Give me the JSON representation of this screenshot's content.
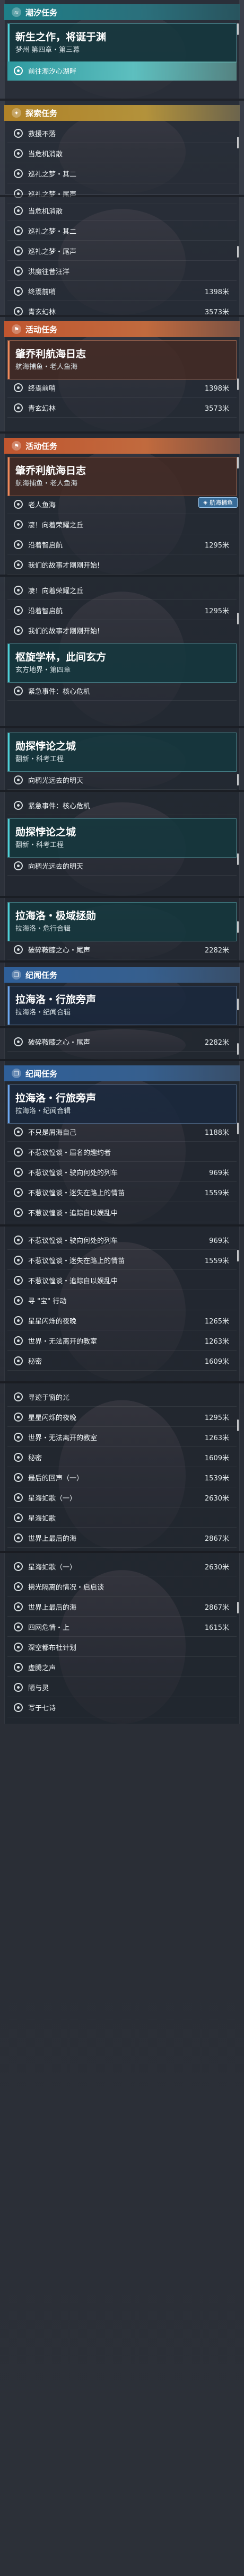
{
  "colors": {
    "teal": "#1e7f88",
    "gold": "#b08228",
    "orange": "#c0562f",
    "blue": "#2f5f98",
    "highlight": "#5dbfbf"
  },
  "screens": [
    {
      "header": {
        "icon": "wave-icon",
        "title": "潮汐任务"
      },
      "card": {
        "title": "新生之作，将诞于渊",
        "subtitle": "梦州 第四章・第三幕"
      },
      "rows": [
        {
          "label": "前往潮汐心湖畔",
          "distance": "",
          "active": true
        }
      ]
    },
    {
      "header": {
        "icon": "compass-icon",
        "title": "探索任务"
      },
      "rows": [
        {
          "label": "救援不落",
          "distance": ""
        },
        {
          "label": "当危机消散",
          "distance": ""
        },
        {
          "label": "巡礼之梦・其二",
          "distance": ""
        },
        {
          "label": "巡礼之梦・尾声",
          "distance": ""
        }
      ]
    },
    {
      "rows": [
        {
          "label": "当危机消散",
          "distance": ""
        },
        {
          "label": "巡礼之梦・其二",
          "distance": ""
        },
        {
          "label": "巡礼之梦・尾声",
          "distance": ""
        },
        {
          "label": "洪魔往昔汪洋",
          "distance": ""
        },
        {
          "label": "终焉前哨",
          "distance": "1398米"
        },
        {
          "label": "青玄幻林",
          "distance": "3573米"
        }
      ]
    },
    {
      "header": {
        "icon": "flag-icon",
        "title": "活动任务"
      },
      "card": {
        "title": "肇乔利航海日志",
        "subtitle": "航海捕鱼・老人鱼海"
      },
      "rows": [
        {
          "label": "终焉前哨",
          "distance": "1398米"
        },
        {
          "label": "青玄幻林",
          "distance": "3573米"
        }
      ]
    },
    {
      "header": {
        "icon": "flag-icon",
        "title": "活动任务"
      },
      "card": {
        "title": "肇乔利航海日志",
        "subtitle": "航海捕鱼・老人鱼海"
      },
      "badge": {
        "icon": "map-icon",
        "label": "航海捕鱼"
      },
      "rows": [
        {
          "label": "老人鱼海",
          "distance": ""
        },
        {
          "label": "凄！向着荣耀之丘",
          "distance": ""
        },
        {
          "label": "沿着智启航",
          "distance": "1295米"
        },
        {
          "label": "我们的故事才刚刚开始!",
          "distance": ""
        }
      ]
    },
    {
      "rows": [
        {
          "label": "凄！向着荣耀之丘",
          "distance": ""
        },
        {
          "label": "沿着智启航",
          "distance": "1295米"
        },
        {
          "label": "我们的故事才刚刚开始!",
          "distance": ""
        }
      ],
      "card": {
        "title": "枢旋学林，此间玄方",
        "subtitle": "玄方地界・第四章"
      },
      "rows2": [
        {
          "label": "紧急事件：核心危机",
          "distance": ""
        }
      ]
    },
    {
      "card": {
        "title": "勋探悖论之城",
        "subtitle": "翻新・科考工程"
      },
      "rows": [
        {
          "label": "向稠光远去的明天",
          "distance": ""
        }
      ]
    },
    {
      "rows": [
        {
          "label": "紧急事件：核心危机",
          "distance": ""
        }
      ],
      "card": {
        "title": "勋探悖论之城",
        "subtitle": "翻新・科考工程"
      },
      "rows2": [
        {
          "label": "向稠光远去的明天",
          "distance": ""
        }
      ]
    },
    {
      "card": {
        "title": "拉海洛・极域拯勋",
        "subtitle": "拉海洛・危行合辑"
      },
      "rows": [
        {
          "label": "破碎鞍膝之心・尾声",
          "distance": "2282米"
        }
      ]
    },
    {
      "header": {
        "icon": "book-icon",
        "title": "纪闻任务"
      },
      "card": {
        "title": "拉海洛・行旅旁声",
        "subtitle": "拉海洛・纪闻合辑"
      }
    },
    {
      "rows": [
        {
          "label": "破碎鞍膝之心・尾声",
          "distance": "2282米"
        }
      ]
    },
    {
      "header": {
        "icon": "book-icon",
        "title": "纪闻任务"
      },
      "card": {
        "title": "拉海洛・行旅旁声",
        "subtitle": "拉海洛・纪闻合辑"
      },
      "rows": [
        {
          "label": "不只是屑海自己",
          "distance": "1188米"
        },
        {
          "label": "不惹议惶谈・眉名的趣约者",
          "distance": ""
        },
        {
          "label": "不惹议惶谈・驶向何处的列车",
          "distance": "969米"
        },
        {
          "label": "不惹议惶谈・迷失在路上的情苗",
          "distance": "1559米"
        },
        {
          "label": "不惹议惶谈・追踪自以娱乱中",
          "distance": ""
        }
      ]
    },
    {
      "rows": [
        {
          "label": "不惹议惶谈・驶向何处的列车",
          "distance": "969米"
        },
        {
          "label": "不惹议惶谈・迷失在路上的情苗",
          "distance": "1559米"
        },
        {
          "label": "不惹议惶谈・追踪自以娱乱中",
          "distance": ""
        },
        {
          "label": "寻 \"宝\" 行动",
          "distance": ""
        },
        {
          "label": "星星闪烁的夜晚",
          "distance": "1265米"
        },
        {
          "label": "世界・无法离开的教室",
          "distance": "1263米"
        },
        {
          "label": "秘密",
          "distance": "1609米"
        }
      ]
    },
    {
      "rows": [
        {
          "label": "寻迹于窗的光",
          "distance": ""
        },
        {
          "label": "星星闪烁的夜晚",
          "distance": "1295米"
        },
        {
          "label": "世界・无法离开的教室",
          "distance": "1263米"
        },
        {
          "label": "秘密",
          "distance": "1609米"
        },
        {
          "label": "最后的回声（一）",
          "distance": "1539米"
        },
        {
          "label": "星海如歌（一）",
          "distance": "2630米"
        },
        {
          "label": "星海如歌",
          "distance": ""
        },
        {
          "label": "世界上最后的海",
          "distance": "2867米"
        }
      ]
    },
    {
      "rows": [
        {
          "label": "星海如歌（一）",
          "distance": "2630米"
        },
        {
          "label": "拂光隔离的情况・启启谈",
          "distance": ""
        },
        {
          "label": "世界上最后的海",
          "distance": "2867米"
        },
        {
          "label": "四网危情・上",
          "distance": "1615米"
        },
        {
          "label": "深空都布社计划",
          "distance": ""
        },
        {
          "label": "虚腾之声",
          "distance": ""
        },
        {
          "label": "陋与灵",
          "distance": ""
        },
        {
          "label": "写于七诗",
          "distance": ""
        }
      ]
    }
  ]
}
